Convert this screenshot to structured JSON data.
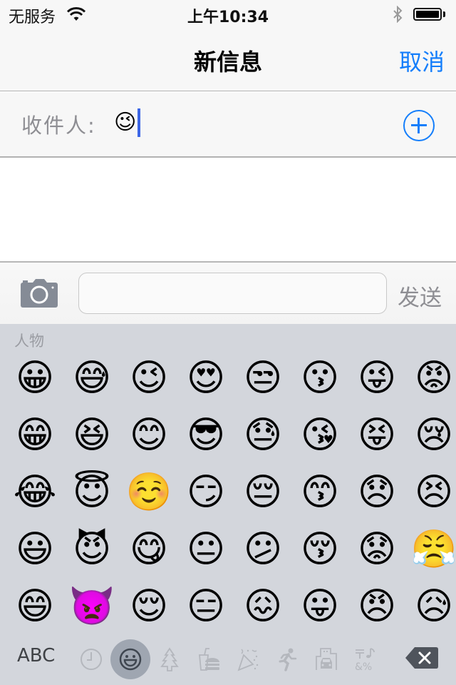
{
  "status_bar": {
    "carrier": "无服务",
    "time": "上午10:34",
    "battery_level": 1.0
  },
  "nav": {
    "title": "新信息",
    "cancel_label": "取消"
  },
  "recipient": {
    "label": "收件人:",
    "value": "😉"
  },
  "composer": {
    "placeholder": "",
    "value": "",
    "send_label": "发送"
  },
  "keyboard": {
    "category_label": "人物",
    "abc_label": "ABC",
    "emoji_rows": [
      [
        "😀",
        "😅",
        "😉",
        "😍",
        "😒",
        "😗",
        "😜",
        "😡"
      ],
      [
        "😁",
        "😆",
        "😊",
        "😎",
        "😓",
        "😘",
        "😝",
        "😢"
      ],
      [
        "😂",
        "😇",
        "☺️",
        "😏",
        "😔",
        "😙",
        "😞",
        "😣"
      ],
      [
        "😃",
        "😈",
        "😋",
        "😐",
        "😕",
        "😚",
        "😟",
        "😤"
      ],
      [
        "😄",
        "👿",
        "😌",
        "😑",
        "😖",
        "😛",
        "😠",
        "😥"
      ]
    ],
    "categories": [
      {
        "name": "recent",
        "icon": "clock-icon",
        "active": false
      },
      {
        "name": "people",
        "icon": "smiley-icon",
        "active": true
      },
      {
        "name": "nature",
        "icon": "tree-icon",
        "active": false
      },
      {
        "name": "food",
        "icon": "burger-icon",
        "active": false
      },
      {
        "name": "celebration",
        "icon": "party-popper-icon",
        "active": false
      },
      {
        "name": "activity",
        "icon": "runner-icon",
        "active": false
      },
      {
        "name": "places",
        "icon": "building-car-icon",
        "active": false
      },
      {
        "name": "symbols",
        "icon": "symbols-icon",
        "active": false
      }
    ]
  },
  "colors": {
    "accent": "#147efb",
    "caret": "#3c66e6",
    "keyboard_bg": "#d3d6dc",
    "bar_bg": "#f7f7f7"
  }
}
